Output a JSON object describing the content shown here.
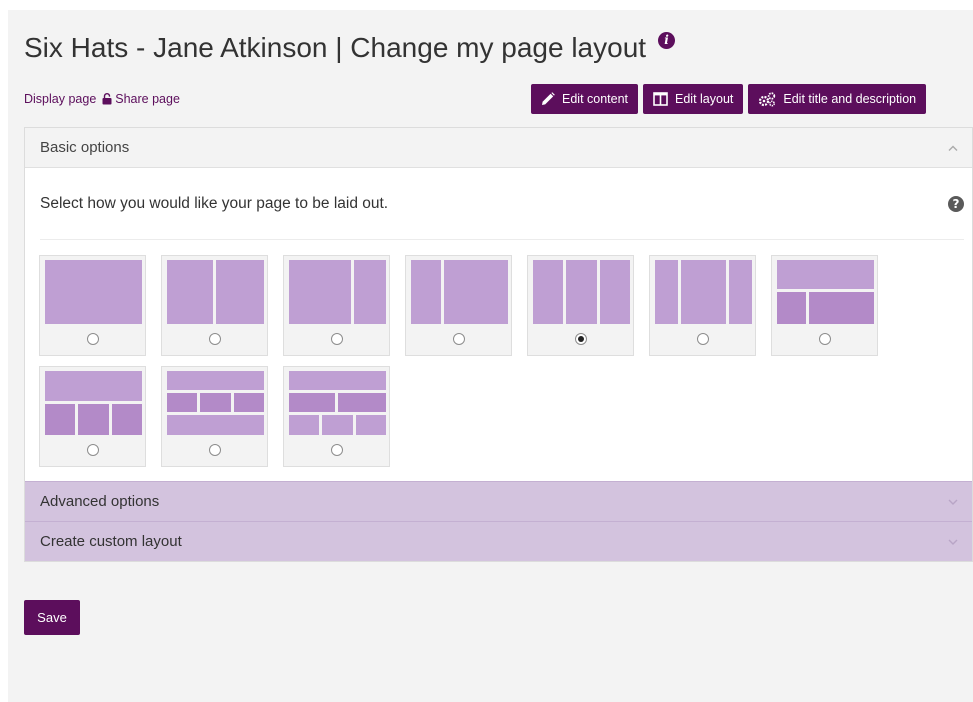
{
  "page": {
    "title": "Six Hats - Jane Atkinson | Change my page layout",
    "info_icon": "info-circle-icon"
  },
  "links": {
    "display_page": "Display page",
    "share_page": "Share page",
    "share_icon": "lock-icon"
  },
  "toolbar": {
    "edit_content": "Edit content",
    "edit_layout": "Edit layout",
    "edit_title": "Edit title and description",
    "colors": {
      "button_bg": "#5c0e5c",
      "button_text": "#ffffff"
    }
  },
  "sections": {
    "basic": {
      "title": "Basic options",
      "state": "expanded",
      "prompt": "Select how you would like your page to be laid out.",
      "help_icon": "question-circle-icon"
    },
    "advanced": {
      "title": "Advanced options",
      "state": "collapsed"
    },
    "custom": {
      "title": "Create custom layout",
      "state": "collapsed"
    }
  },
  "layouts": [
    {
      "id": "one-column",
      "selected": false
    },
    {
      "id": "two-equal-columns",
      "selected": false
    },
    {
      "id": "two-columns-wide-left",
      "selected": false
    },
    {
      "id": "two-columns-wide-right",
      "selected": false
    },
    {
      "id": "three-equal-columns",
      "selected": true
    },
    {
      "id": "three-columns-wide-middle",
      "selected": false
    },
    {
      "id": "one-row-then-two-columns",
      "selected": false
    },
    {
      "id": "one-row-then-three-columns",
      "selected": false
    },
    {
      "id": "row-three-columns-row",
      "selected": false
    },
    {
      "id": "row-two-columns-three-columns",
      "selected": false
    }
  ],
  "actions": {
    "save": "Save"
  },
  "colors": {
    "accent": "#5c0e5c",
    "thumb_fill": "#bf9fd3",
    "collapsed_header_bg": "#d3c3de"
  }
}
